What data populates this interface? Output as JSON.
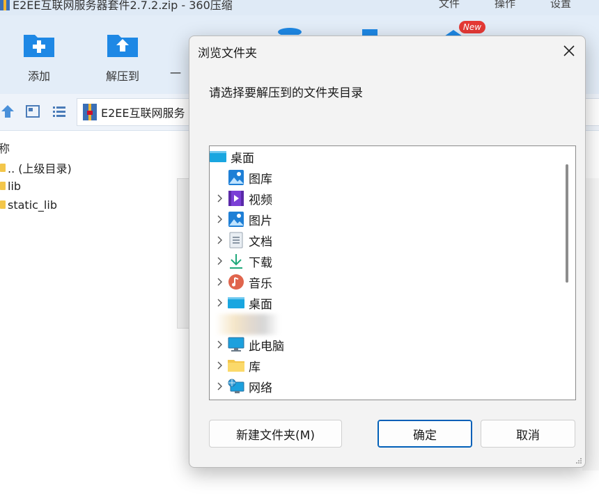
{
  "app": {
    "title": "E2EE互联网服务器套件2.7.2.zip - 360压缩",
    "menu": [
      "文件",
      "操作",
      "设置"
    ],
    "toolbar": [
      {
        "label": "添加",
        "icon": "add-folder-icon"
      },
      {
        "label": "解压到",
        "icon": "extract-folder-icon"
      },
      {
        "label": "一",
        "icon": "partial-tool-icon"
      }
    ],
    "new_badge": "New",
    "address": "E2EE互联网服务",
    "file_column_header": "称",
    "files": [
      {
        "name": ".. (上级目录)"
      },
      {
        "name": "lib"
      },
      {
        "name": "static_lib"
      }
    ]
  },
  "dialog": {
    "title": "浏览文件夹",
    "prompt": "请选择要解压到的文件夹目录",
    "tree": [
      {
        "label": "桌面",
        "icon": "desktop-icon",
        "level": 0,
        "expandable": false
      },
      {
        "label": "图库",
        "icon": "gallery-icon",
        "level": 1,
        "expandable": false
      },
      {
        "label": "视频",
        "icon": "video-icon",
        "level": 1,
        "expandable": true
      },
      {
        "label": "图片",
        "icon": "pictures-icon",
        "level": 1,
        "expandable": true
      },
      {
        "label": "文档",
        "icon": "documents-icon",
        "level": 1,
        "expandable": true
      },
      {
        "label": "下载",
        "icon": "download-icon",
        "level": 1,
        "expandable": true
      },
      {
        "label": "音乐",
        "icon": "music-icon",
        "level": 1,
        "expandable": true
      },
      {
        "label": "桌面",
        "icon": "desktop-icon",
        "level": 1,
        "expandable": true
      },
      {
        "label": "此电脑",
        "icon": "computer-icon",
        "level": 1,
        "expandable": true
      },
      {
        "label": "库",
        "icon": "library-folder-icon",
        "level": 1,
        "expandable": true
      },
      {
        "label": "网络",
        "icon": "network-icon",
        "level": 1,
        "expandable": true
      }
    ],
    "buttons": {
      "new_folder": "新建文件夹(M)",
      "ok": "确定",
      "cancel": "取消"
    }
  },
  "colors": {
    "toolbar_bg": "#e3edf8",
    "accent": "#005fb8",
    "icon_blue": "#1e88e5",
    "badge_red": "#e53935"
  }
}
